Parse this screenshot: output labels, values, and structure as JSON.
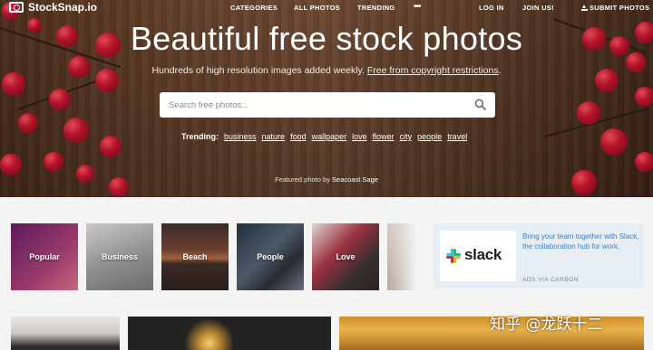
{
  "nav": {
    "logo_text": "StockSnap.io",
    "links": [
      "CATEGORIES",
      "ALL PHOTOS",
      "TRENDING"
    ],
    "more": "•••",
    "login": "LOG IN",
    "join": "JOIN US!",
    "submit": "SUBMIT PHOTOS"
  },
  "hero": {
    "headline": "Beautiful free stock photos",
    "subline_prefix": "Hundreds of high resolution images added weekly. ",
    "subline_link": "Free from copyright restrictions",
    "subline_suffix": ".",
    "search_placeholder": "Search free photos...",
    "trending_label": "Trending:",
    "trending_tags": [
      "business",
      "nature",
      "food",
      "wallpaper",
      "love",
      "flower",
      "city",
      "people",
      "travel"
    ],
    "featured_prefix": "Featured photo by ",
    "featured_author": "Seacoast Sage"
  },
  "categories": [
    {
      "label": "Popular",
      "color": "#7a2a6a"
    },
    {
      "label": "Business",
      "color": "#8a8a8a"
    },
    {
      "label": "Beach",
      "color": "#5a3a2a"
    },
    {
      "label": "People",
      "color": "#3a4250"
    },
    {
      "label": "Love",
      "color": "#6a5a5a"
    },
    {
      "label": "",
      "color": "#b8a8a0"
    }
  ],
  "ad": {
    "brand": "slack",
    "text": "Bring your team together with Slack, the collaboration hub for work.",
    "via": "ADS VIA CARBON"
  },
  "watermark": "知乎 @龙跃十二"
}
